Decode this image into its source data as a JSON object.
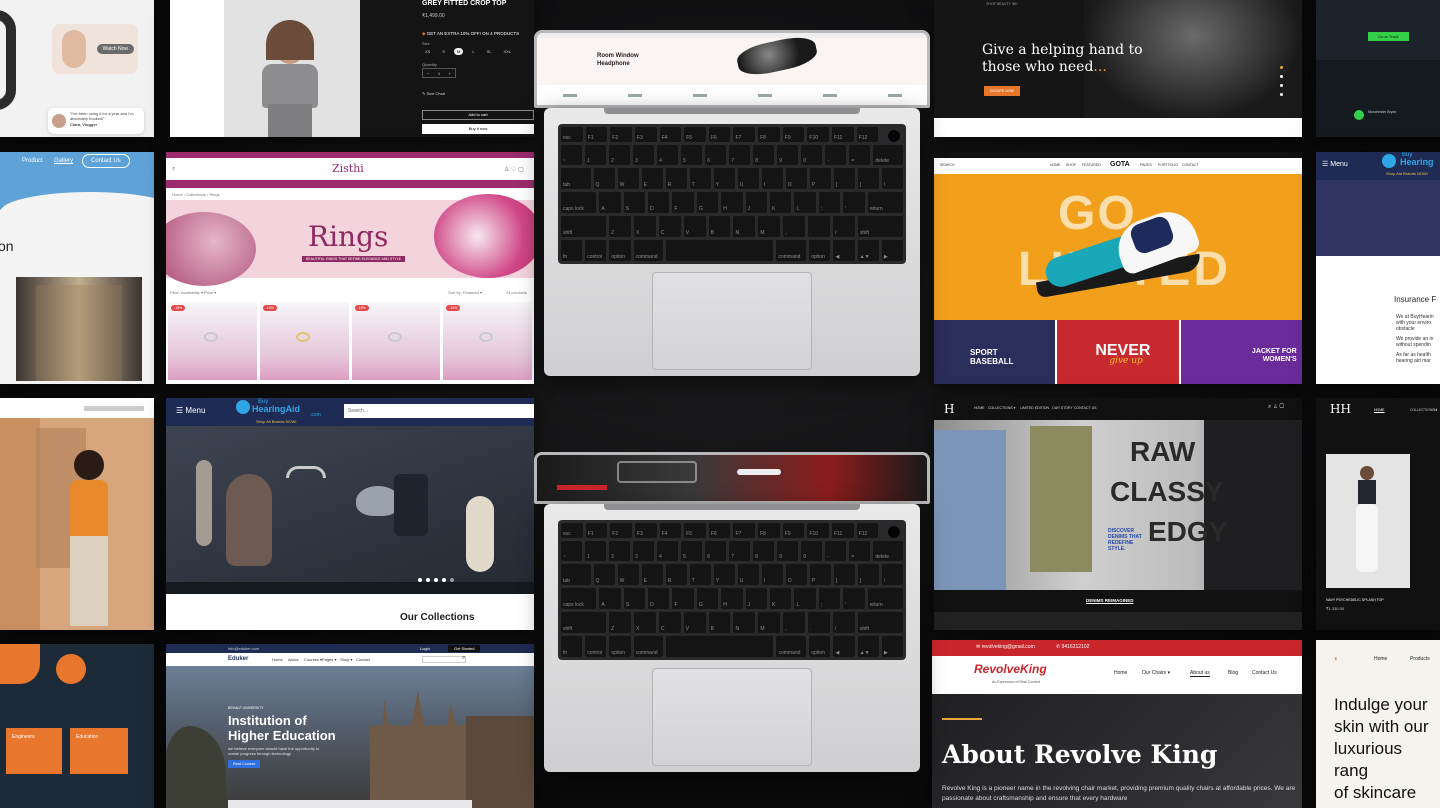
{
  "tiles": {
    "c1a": {
      "button": "Watch Now",
      "quote": "\"I've been using it for a year and I'm absolutely hooked!\"",
      "author": "Clara, Vlogger"
    },
    "c1b": {
      "nav": [
        "Product",
        "Gallery",
        "Contact Us"
      ],
      "heading_fragment": "on"
    },
    "c1d": {
      "cards": [
        "Engineers",
        "Education"
      ]
    },
    "c2a": {
      "title": "GREY FITTED CROP TOP",
      "price": "₹1,499.00",
      "offer": "GET AN EXTRA 10% OFF! ON 4 PRODUCTS",
      "size_label": "Size",
      "sizes": [
        "XS",
        "S",
        "M",
        "L",
        "XL",
        "XXL"
      ],
      "qty_label": "Quantity",
      "qty": "1",
      "size_chart": "Size Chart",
      "add_to_cart": "Add to cart",
      "buy_now": "Buy it now"
    },
    "c2b": {
      "brand": "Zisthi",
      "breadcrumb": "Home  ›  Collections  ›  Rings",
      "hero_title": "Rings",
      "hero_sub": "BEAUTIFUL RINGS THAT DEFINE ELEGANCE AND STYLE",
      "filter": "Filter:  Availability  ▾   Price  ▾",
      "sort": "Sort by:  Featured  ▾",
      "count": "24 products",
      "badges": [
        "-15%",
        "-15%",
        "-15%",
        "-15%"
      ]
    },
    "c2c": {
      "menu": "Menu",
      "logo_top": "Buy",
      "logo_main": "HearingAid",
      "logo_sub": ".com",
      "tagline": "Shop All Brands NOW!",
      "search_placeholder": "Search...",
      "section": "Our Collections"
    },
    "c2d": {
      "logo": "Eduker",
      "email": "info@eduker.com",
      "login": "Login",
      "cta": "Get Started",
      "nav": [
        "Home",
        "About",
        "Courses ▾",
        "Pages ▾",
        "Shop ▾",
        "Contact"
      ],
      "kicker": "BEHALF UNIVERSITY",
      "hero_1": "Institution of",
      "hero_2": "Higher Education",
      "hero_body": "we believe everyone should have the opportunity to create progress through technology",
      "hero_btn": "Read Courses"
    },
    "c4a": {
      "topline": "SHOP BEAUTY INK",
      "heading_1": "Give a helping hand to",
      "heading_2": "those who need",
      "ellipsis": "...",
      "button": "DONATE NOW"
    },
    "c4b": {
      "search": "SEARCH",
      "brand": "GOTA",
      "nav": [
        "HOME",
        "SHOP",
        "FEATURED"
      ],
      "nav_right": [
        "PAGES",
        "PORTFOLIO",
        "CONTACT"
      ],
      "hero_1": "GO",
      "hero_2": "LIMITED",
      "cards": [
        "SPORT BASEBALL",
        "NEVER",
        "JACKET FOR WOMEN'S"
      ],
      "card_script": "give up"
    },
    "c4c": {
      "logo": "H",
      "nav": [
        "HOME",
        "COLLECTIONS ▾",
        "LIMITED EDITION",
        "OUR STORY",
        "CONTACT US"
      ],
      "hero_1": "RAW",
      "hero_2": "CLASSY",
      "hero_3": "EDGY",
      "hero_sub": "DISCOVER DENIMS THAT REDEFINE STYLE.",
      "link": "DENIMS REIMAGINED"
    },
    "c4d": {
      "email": "revolveking@gmail.com",
      "phone": "9416212102",
      "brand": "RevolveKing",
      "brand_sub": "An Expression of Real Comfort",
      "nav": [
        "Home",
        "Our Chairs ▾",
        "About us",
        "Blog",
        "Contact Us"
      ],
      "heading": "About Revolve King",
      "body": "Revolve  King is a pioneer name in the revolving chair market, providing premium quality chairs at affordable prices. We are passionate about craftsmanship and ensure that every hardware"
    },
    "c5a": {
      "button": "Go to Track",
      "user": "Manchester Bryan"
    },
    "c5b": {
      "menu": "Menu",
      "logo_top": "Buy",
      "logo_main": "Hearing",
      "tagline": "Shop Aid Brands NOW!",
      "heading": "Insurance F",
      "p1": "We at BuyHearin",
      "p1b": "with your enviro",
      "p1c": "obstacle",
      "p2": "We provide an in",
      "p2b": "without spendin",
      "p3": "As far as health",
      "p3b": "hearing aid mar"
    },
    "c5c": {
      "nav": [
        "HOME",
        "COLLECTIONS ▾",
        "LI"
      ],
      "product": "NAVY PSYCHEDELIC SPLASH TOP",
      "price": "₹1,330.00"
    },
    "c5d": {
      "nav": [
        "Home",
        "Products"
      ],
      "hero": [
        "Indulge your",
        "skin with our",
        "luxurious rang",
        "of skincare",
        "products"
      ]
    }
  },
  "laptops": {
    "top_screen": {
      "title_1": "Room Window",
      "title_2": "Headphone"
    },
    "keyboard_rows": [
      [
        "esc",
        "F1",
        "F2",
        "F3",
        "F4",
        "F5",
        "F6",
        "F7",
        "F8",
        "F9",
        "F10",
        "F11",
        "F12",
        ""
      ],
      [
        "~",
        "1",
        "2",
        "3",
        "4",
        "5",
        "6",
        "7",
        "8",
        "9",
        "0",
        "-",
        "=",
        "delete"
      ],
      [
        "tab",
        "Q",
        "W",
        "E",
        "R",
        "T",
        "Y",
        "U",
        "I",
        "O",
        "P",
        "[",
        "]",
        "\\"
      ],
      [
        "caps lock",
        "A",
        "S",
        "D",
        "F",
        "G",
        "H",
        "J",
        "K",
        "L",
        ";",
        "'",
        "return"
      ],
      [
        "shift",
        "Z",
        "X",
        "C",
        "V",
        "B",
        "N",
        "M",
        ",",
        ".",
        "/",
        "shift"
      ],
      [
        "fn",
        "control",
        "option",
        "command",
        "",
        "command",
        "option",
        "◀",
        "▲▼",
        "▶"
      ]
    ]
  },
  "colors": {
    "accent_orange": "#e8762d",
    "zisthi_magenta": "#9b2b6c",
    "gota_yellow": "#f2a01c",
    "revolve_red": "#c9262c",
    "hearing_navy": "#1e2b55"
  }
}
